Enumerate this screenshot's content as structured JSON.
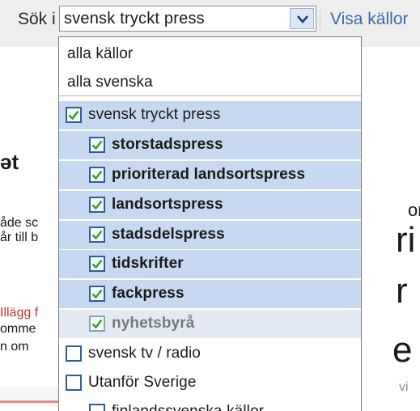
{
  "search": {
    "label": "Sök i",
    "selected_value": "svensk tryckt press",
    "show_sources": "Visa källor"
  },
  "background": {
    "heading": "ət",
    "line1": "åde sc",
    "line2": "år till b",
    "line3": "Illägg f",
    "line4": "omme",
    "line5": "n om",
    "right1": "or",
    "right2": "ri",
    "right3": "r",
    "right4": "e",
    "right5": "vi"
  },
  "dropdown": {
    "options": [
      {
        "label": "alla källor",
        "checkbox": false,
        "checked": false,
        "indent": 0,
        "bold": false
      },
      {
        "label": "alla svenska",
        "checkbox": false,
        "checked": false,
        "indent": 0,
        "bold": false
      },
      {
        "label": "svensk tryckt press",
        "checkbox": true,
        "checked": true,
        "indent": 0,
        "bold": false
      },
      {
        "label": "storstadspress",
        "checkbox": true,
        "checked": true,
        "indent": 1,
        "bold": true
      },
      {
        "label": "prioriterad landsortspress",
        "checkbox": true,
        "checked": true,
        "indent": 1,
        "bold": true
      },
      {
        "label": "landsortspress",
        "checkbox": true,
        "checked": true,
        "indent": 1,
        "bold": true
      },
      {
        "label": "stadsdelspress",
        "checkbox": true,
        "checked": true,
        "indent": 1,
        "bold": true
      },
      {
        "label": "tidskrifter",
        "checkbox": true,
        "checked": true,
        "indent": 1,
        "bold": true
      },
      {
        "label": "fackpress",
        "checkbox": true,
        "checked": true,
        "indent": 1,
        "bold": true
      },
      {
        "label": "nyhetsbyrå",
        "checkbox": true,
        "checked": true,
        "indent": 1,
        "bold": true
      },
      {
        "label": "svensk tv / radio",
        "checkbox": true,
        "checked": false,
        "indent": 0,
        "bold": false
      },
      {
        "label": "Utanför Sverige",
        "checkbox": true,
        "checked": false,
        "indent": 0,
        "bold": false
      },
      {
        "label": "finlandssvenska källor",
        "checkbox": true,
        "checked": false,
        "indent": 1,
        "bold": false
      }
    ]
  },
  "colors": {
    "selected_bg": "#c6d9f1",
    "link": "#3b6aa5",
    "checkbox_border": "#2f5d9a",
    "checkmark": "#2e9a35"
  }
}
